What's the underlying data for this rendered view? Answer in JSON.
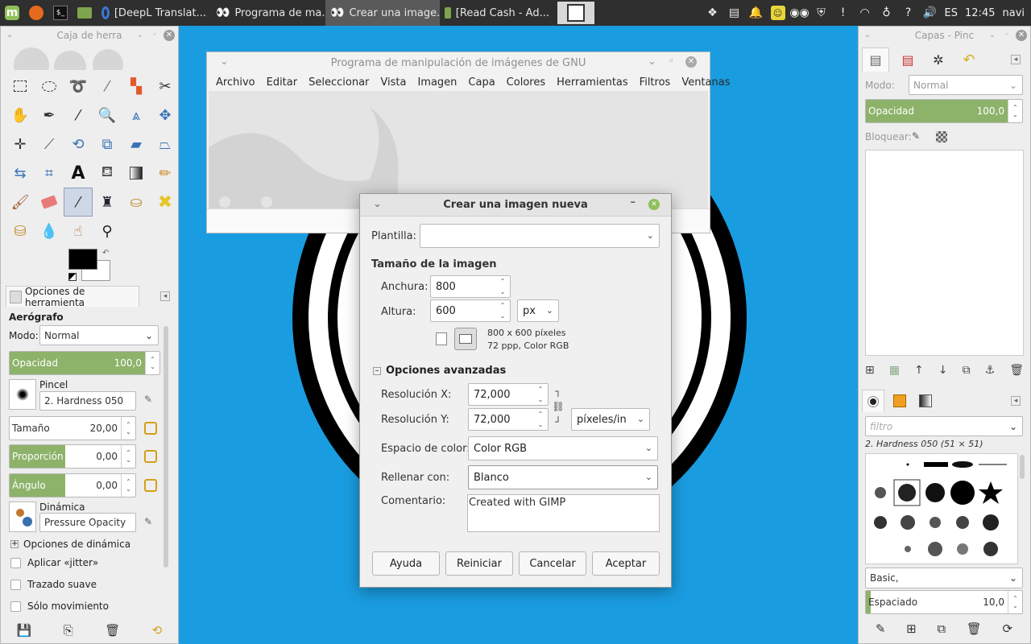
{
  "taskbar": {
    "tasks": [
      {
        "label": "[DeepL Translat...",
        "active": false
      },
      {
        "label": "Programa de ma...",
        "active": false
      },
      {
        "label": "Crear una image...",
        "active": true
      },
      {
        "label": "[Read Cash - Ad...",
        "active": false
      }
    ],
    "tray": {
      "language": "ES",
      "time": "12:45",
      "user": "navi"
    }
  },
  "toolbox": {
    "title": "Caja de herra",
    "tool_options_tab": "Opciones de herramienta",
    "tool_name": "Aerógrafo",
    "mode_label": "Modo:",
    "mode_value": "Normal",
    "opacity_label": "Opacidad",
    "opacity_value": "100,0",
    "brush_label": "Pincel",
    "brush_value": "2. Hardness 050",
    "size_label": "Tamaño",
    "size_value": "20,00",
    "aspect_label": "Proporción de as...",
    "aspect_value": "0,00",
    "angle_label": "Ángulo",
    "angle_value": "0,00",
    "dynamics_label": "Dinámica",
    "dynamics_value": "Pressure Opacity",
    "dynamics_options": "Opciones de dinámica",
    "jitter": "Aplicar «jitter»",
    "smooth": "Trazado suave",
    "motion_only": "Sólo movimiento"
  },
  "mainwin": {
    "title": "Programa de manipulación de imágenes de GNU",
    "menus": [
      "Archivo",
      "Editar",
      "Seleccionar",
      "Vista",
      "Imagen",
      "Capa",
      "Colores",
      "Herramientas",
      "Filtros",
      "Ventanas"
    ]
  },
  "dialog": {
    "title": "Crear una imagen nueva",
    "template_label": "Plantilla:",
    "template_value": "",
    "size_header": "Tamaño de la imagen",
    "width_label": "Anchura:",
    "width_value": "800",
    "height_label": "Altura:",
    "height_value": "600",
    "unit_value": "px",
    "info_line1": "800 x 600 píxeles",
    "info_line2": "72 ppp, Color RGB",
    "advanced_header": "Opciones avanzadas",
    "xres_label": "Resolución X:",
    "xres_value": "72,000",
    "yres_label": "Resolución Y:",
    "yres_value": "72,000",
    "res_unit": "píxeles/in",
    "colorspace_label": "Espacio de color:",
    "colorspace_value": "Color RGB",
    "fill_label": "Rellenar con:",
    "fill_value": "Blanco",
    "comment_label": "Comentario:",
    "comment_value": "Created with GIMP",
    "buttons": {
      "help": "Ayuda",
      "reset": "Reiniciar",
      "cancel": "Cancelar",
      "ok": "Aceptar"
    }
  },
  "layers": {
    "title": "Capas - Pinc",
    "mode_label": "Modo:",
    "mode_value": "Normal",
    "opacity_label": "Opacidad",
    "opacity_value": "100,0",
    "lock_label": "Bloquear:"
  },
  "brushes": {
    "filter_placeholder": "filtro",
    "current": "2. Hardness 050 (51 × 51)",
    "tag_value": "Basic,",
    "spacing_label": "Espaciado",
    "spacing_value": "10,0"
  },
  "colors": {
    "accent_green": "#8db26a",
    "desktop_blue": "#1a9ce0",
    "panel": "#2f2f2f"
  }
}
